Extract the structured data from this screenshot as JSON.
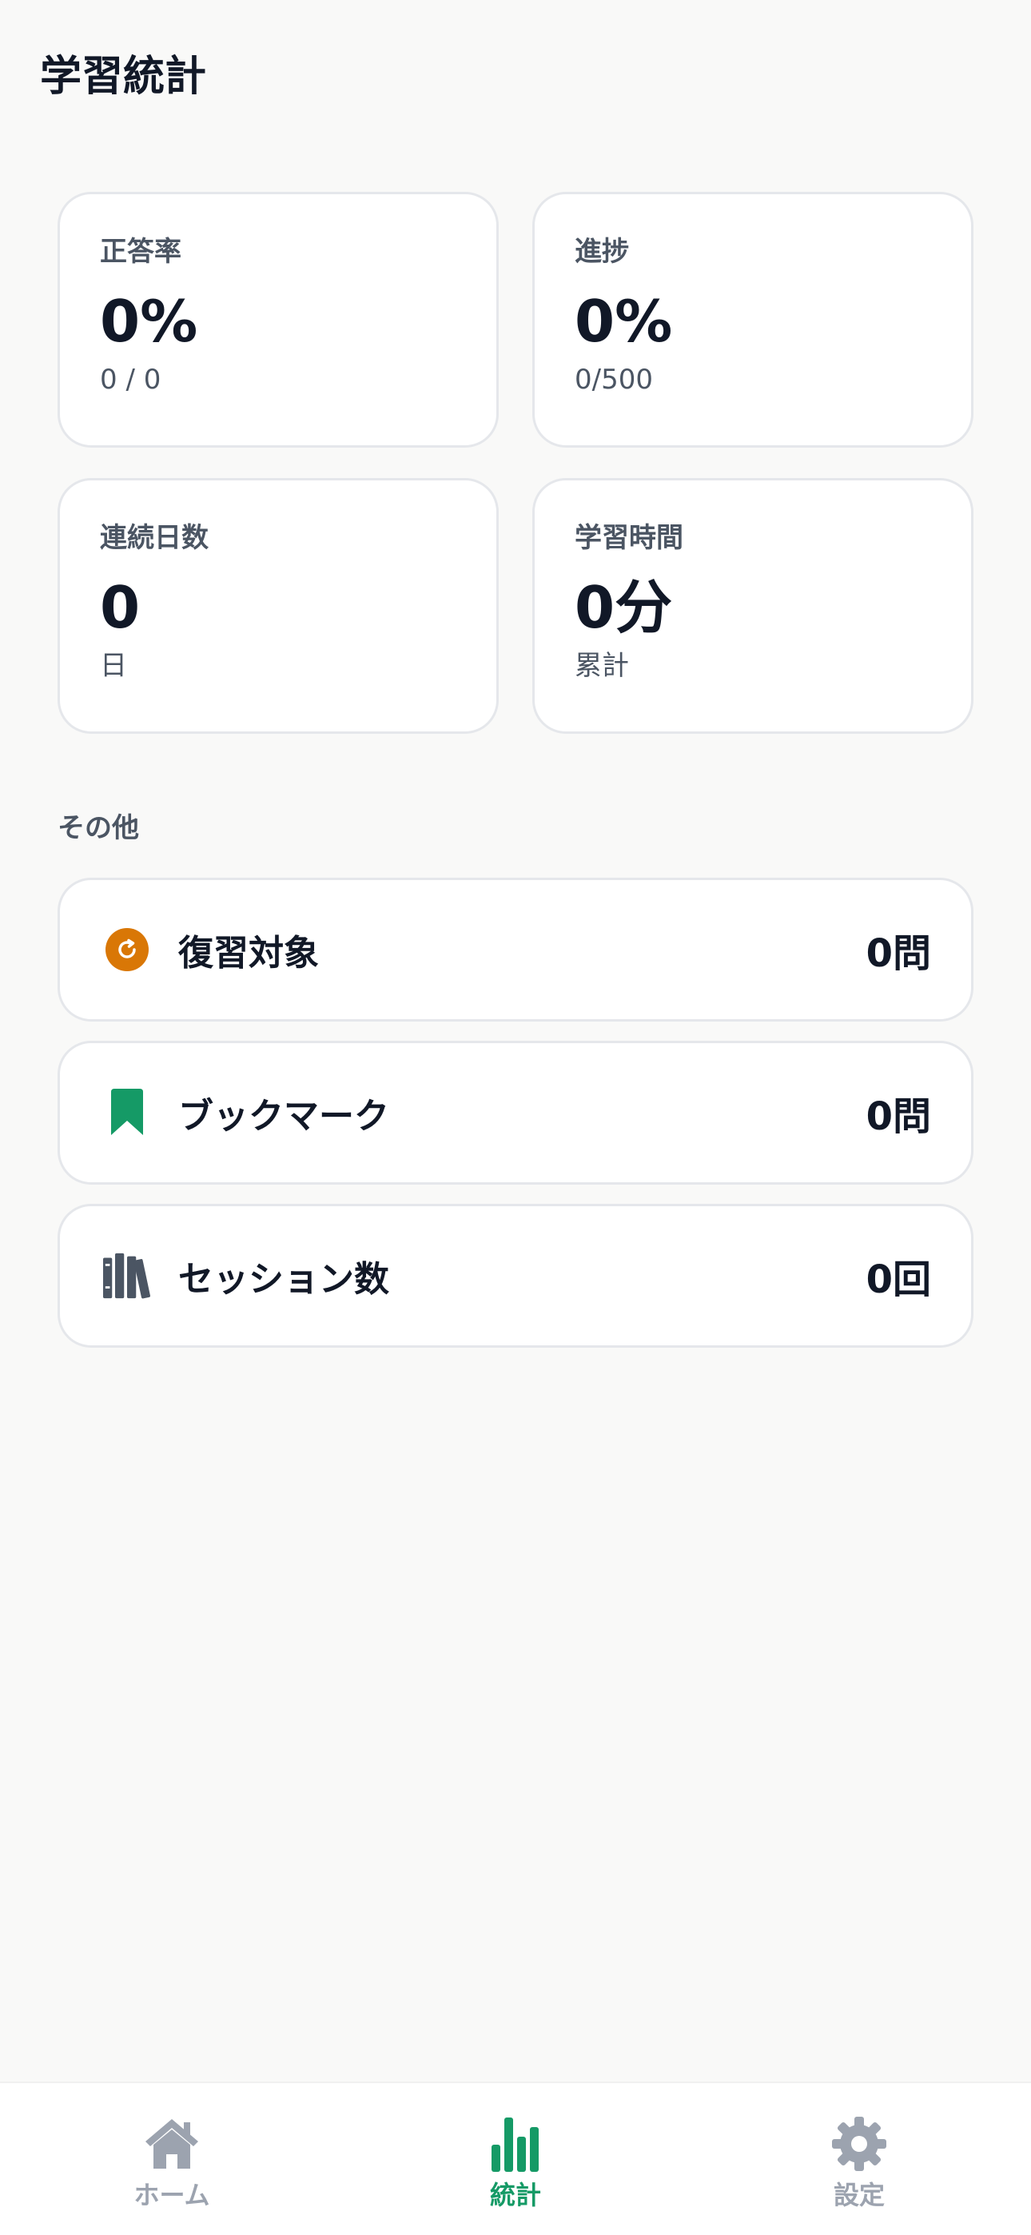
{
  "header": {
    "title": "学習統計"
  },
  "stats": [
    {
      "label": "正答率",
      "value": "0%",
      "sub": "0 / 0"
    },
    {
      "label": "進捗",
      "value": "0%",
      "sub": "0/500"
    },
    {
      "label": "連続日数",
      "value": "0",
      "sub": "日"
    },
    {
      "label": "学習時間",
      "value": "0分",
      "sub": "累計"
    }
  ],
  "other": {
    "title": "その他",
    "items": [
      {
        "label": "復習対象",
        "value": "0問",
        "icon": "refresh-icon"
      },
      {
        "label": "ブックマーク",
        "value": "0問",
        "icon": "bookmark-icon"
      },
      {
        "label": "セッション数",
        "value": "0回",
        "icon": "books-icon"
      }
    ]
  },
  "tabbar": {
    "items": [
      {
        "label": "ホーム",
        "icon": "home-icon",
        "active": false
      },
      {
        "label": "統計",
        "icon": "bar-chart-icon",
        "active": true
      },
      {
        "label": "設定",
        "icon": "gear-icon",
        "active": false
      }
    ]
  },
  "colors": {
    "accent": "#159a66",
    "review_icon": "#d97706",
    "muted_icon": "#4b5563",
    "inactive_tab": "#9ca3af"
  }
}
